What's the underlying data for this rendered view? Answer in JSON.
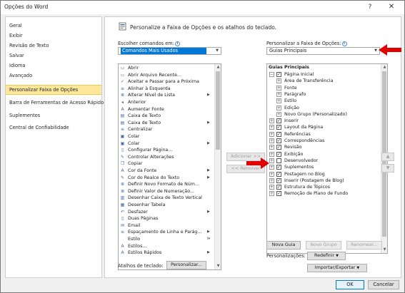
{
  "window": {
    "title": "Opções do Word",
    "help": "?",
    "close": "✕"
  },
  "nav": {
    "items": [
      {
        "label": "Geral",
        "active": false
      },
      {
        "label": "Exibir",
        "active": false
      },
      {
        "label": "Revisão de Texto",
        "active": false
      },
      {
        "label": "Salvar",
        "active": false
      },
      {
        "label": "Idioma",
        "active": false
      },
      {
        "label": "Avançado",
        "active": false
      },
      {
        "label": "Personalizar Faixa de Opções",
        "active": true
      },
      {
        "label": "Barra de Ferramentas de Acesso Rápido",
        "active": false
      },
      {
        "label": "Suplementos",
        "active": false
      },
      {
        "label": "Central de Confiabilidade",
        "active": false
      }
    ]
  },
  "main": {
    "heading": "Personalize a Faixa de Opções e os atalhos do teclado.",
    "choose_label": "Escolher comandos em:",
    "choose_value": "Comandos Mais Usados",
    "customize_label": "Personalizar a Faixa de Opções:",
    "customize_value": "Guias Principais",
    "add_button": "Adicionar >>",
    "remove_button": "<< Remover",
    "commands": [
      {
        "label": "Abrir",
        "icon": "folder-icon",
        "glyph": "▭",
        "sub": ""
      },
      {
        "label": "Abrir Arquivo Recente...",
        "icon": "recent-file-icon",
        "glyph": "▭",
        "sub": ""
      },
      {
        "label": "Aceitar e Passar para a Próxima",
        "icon": "accept-change-icon",
        "glyph": "✓",
        "sub": ""
      },
      {
        "label": "Alinhar à Esquerda",
        "icon": "align-left-icon",
        "glyph": "≡",
        "sub": ""
      },
      {
        "label": "Alterar Nível de Lista",
        "icon": "list-level-icon",
        "glyph": "≣",
        "sub": "▶"
      },
      {
        "label": "Anterior",
        "icon": "previous-icon",
        "glyph": "◂",
        "sub": ""
      },
      {
        "label": "Aumentar Fonte",
        "icon": "grow-font-icon",
        "glyph": "A",
        "sub": ""
      },
      {
        "label": "Caixa de Texto",
        "icon": "textbox-icon",
        "glyph": "▤",
        "sub": ""
      },
      {
        "label": "Caixa de Texto",
        "icon": "textbox-menu-icon",
        "glyph": "▤",
        "sub": "▶"
      },
      {
        "label": "Centralizar",
        "icon": "align-center-icon",
        "glyph": "≡",
        "sub": ""
      },
      {
        "label": "Colar",
        "icon": "paste-icon",
        "glyph": "▣",
        "sub": ""
      },
      {
        "label": "Colar",
        "icon": "paste-menu-icon",
        "glyph": "▣",
        "sub": "▶"
      },
      {
        "label": "Configurar Página...",
        "icon": "page-setup-icon",
        "glyph": "▯",
        "sub": ""
      },
      {
        "label": "Controlar Alterações",
        "icon": "track-changes-icon",
        "glyph": "✎",
        "sub": ""
      },
      {
        "label": "Copiar",
        "icon": "copy-icon",
        "glyph": "❐",
        "sub": ""
      },
      {
        "label": "Cor da Fonte",
        "icon": "font-color-icon",
        "glyph": "A",
        "sub": "▶"
      },
      {
        "label": "Cor do Realce do Texto",
        "icon": "highlight-icon",
        "glyph": "✎",
        "sub": "▶"
      },
      {
        "label": "Definir Novo Formato de Núm...",
        "icon": "number-format-icon",
        "glyph": "≣",
        "sub": ""
      },
      {
        "label": "Definir Valor de Numeração...",
        "icon": "numbering-value-icon",
        "glyph": "≣",
        "sub": ""
      },
      {
        "label": "Desenhar Caixa de Texto Vertical",
        "icon": "vertical-textbox-icon",
        "glyph": "▥",
        "sub": ""
      },
      {
        "label": "Desenhar Tabela",
        "icon": "draw-table-icon",
        "glyph": "▦",
        "sub": ""
      },
      {
        "label": "Desfazer",
        "icon": "undo-icon",
        "glyph": "↶",
        "sub": "▶"
      },
      {
        "label": "Duas Páginas",
        "icon": "two-pages-icon",
        "glyph": "▯",
        "sub": ""
      },
      {
        "label": "Email",
        "icon": "email-icon",
        "glyph": "✉",
        "sub": ""
      },
      {
        "label": "Espaçamento de Linha e Parág...",
        "icon": "line-spacing-icon",
        "glyph": "≡",
        "sub": "▶"
      },
      {
        "label": "Estilo",
        "icon": "style-icon",
        "glyph": "",
        "sub": "I▾"
      },
      {
        "label": "Estilos...",
        "icon": "styles-icon",
        "glyph": "A",
        "sub": ""
      },
      {
        "label": "Estilos Rápidos",
        "icon": "quick-styles-icon",
        "glyph": "A",
        "sub": "▶"
      }
    ],
    "tree_header": "Guias Principais",
    "tree": [
      {
        "label": "Página Inicial",
        "level": 1,
        "expand": "⊟",
        "checked": true
      },
      {
        "label": "Área de Transferência",
        "level": 2,
        "expand": "⊞",
        "checked": null
      },
      {
        "label": "Fonte",
        "level": 2,
        "expand": "⊞",
        "checked": null
      },
      {
        "label": "Parágrafo",
        "level": 2,
        "expand": "⊞",
        "checked": null
      },
      {
        "label": "Estilo",
        "level": 2,
        "expand": "⊞",
        "checked": null
      },
      {
        "label": "Edição",
        "level": 2,
        "expand": "⊞",
        "checked": null
      },
      {
        "label": "Novo Grupo (Personalizado)",
        "level": 2,
        "expand": "⊞",
        "checked": null
      },
      {
        "label": "Inserir",
        "level": 1,
        "expand": "⊞",
        "checked": true
      },
      {
        "label": "Layout da Página",
        "level": 1,
        "expand": "⊞",
        "checked": true
      },
      {
        "label": "Referências",
        "level": 1,
        "expand": "⊞",
        "checked": true
      },
      {
        "label": "Correspondências",
        "level": 1,
        "expand": "⊞",
        "checked": true
      },
      {
        "label": "Revisão",
        "level": 1,
        "expand": "⊞",
        "checked": true
      },
      {
        "label": "Exibição",
        "level": 1,
        "expand": "⊞",
        "checked": true
      },
      {
        "label": "Desenvolvedor",
        "level": 1,
        "expand": "⊞",
        "checked": false
      },
      {
        "label": "Suplementos",
        "level": 1,
        "expand": "⊞",
        "checked": true
      },
      {
        "label": "Postagem no Blog",
        "level": 1,
        "expand": "⊞",
        "checked": true
      },
      {
        "label": "Inserir (Postagem de Blog)",
        "level": 1,
        "expand": "⊞",
        "checked": true
      },
      {
        "label": "Estrutura de Tópicos",
        "level": 1,
        "expand": "⊞",
        "checked": true
      },
      {
        "label": "Remoção de Plano de Fundo",
        "level": 1,
        "expand": "⊞",
        "checked": true
      }
    ],
    "new_tab_button": "Nova Guia",
    "new_group_button": "Novo Grupo",
    "rename_button": "Renomear...",
    "customizations_label": "Personalizações:",
    "reset_button": "Redefinir",
    "import_export_button": "Importar/Exportar",
    "shortcuts_label": "Atalhos de teclado:",
    "customize_button": "Personalizar...",
    "move_up": "▲",
    "move_down": "▼"
  },
  "footer": {
    "ok": "OK",
    "cancel": "Cancelar"
  },
  "colors": {
    "selection_blue": "#0078d7",
    "active_nav": "#fde79b",
    "annotation_red": "#e00000"
  }
}
